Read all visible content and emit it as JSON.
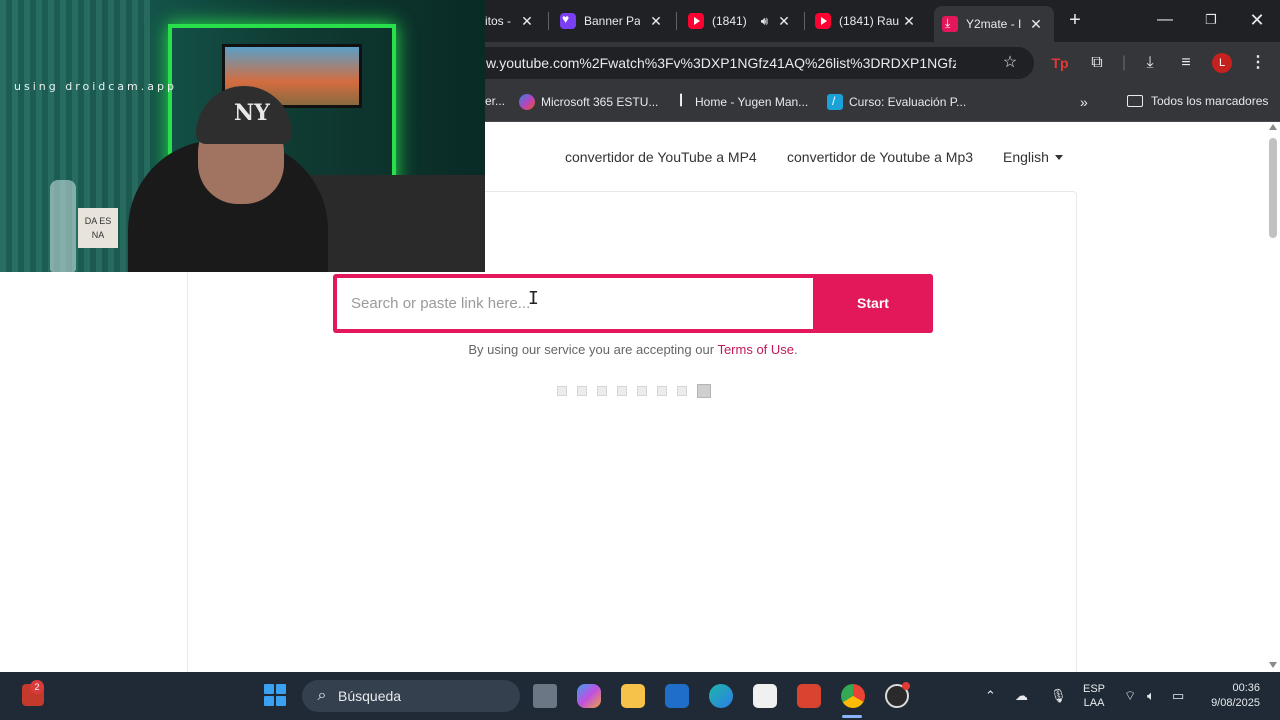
{
  "browser": {
    "tabs": [
      {
        "title": "itos -",
        "favicon": "none",
        "active": false
      },
      {
        "title": "Banner Par",
        "favicon": "canva-heart-icon",
        "active": false
      },
      {
        "title": "(1841)",
        "favicon": "youtube-icon",
        "active": false,
        "audio": true
      },
      {
        "title": "(1841) Rau",
        "favicon": "youtube-icon",
        "active": false
      },
      {
        "title": "Y2mate - I",
        "favicon": "y2mate-icon",
        "active": true
      }
    ],
    "new_tab_label": "+",
    "url": "w.youtube.com%2Fwatch%3Fv%3DXP1NGfz41AQ%26list%3DRDXP1NGfz41AQ...",
    "profile_initial": "L",
    "bookmarks": [
      {
        "label": "er...",
        "icon": "none"
      },
      {
        "label": "Microsoft 365 ESTU...",
        "icon": "microsoft-365-icon"
      },
      {
        "label": "Home - Yugen Man...",
        "icon": "yugen-icon"
      },
      {
        "label": "Curso: Evaluación P...",
        "icon": "course-icon"
      }
    ],
    "all_bookmarks_label": "Todos los marcadores"
  },
  "page": {
    "nav": {
      "mp4_link": "convertidor de YouTube a MP4",
      "mp3_link": "convertidor de Youtube a Mp3",
      "language": "English"
    },
    "search": {
      "placeholder": "Search or paste link here...",
      "button_label": "Start"
    },
    "terms": {
      "prefix": "By using our service you are accepting our ",
      "link": "Terms of Use",
      "suffix": "."
    },
    "loader": {
      "total": 8,
      "active_index": 7
    },
    "accent_color": "#e2185b"
  },
  "webcam": {
    "watermark": "using droidcam.app",
    "cap_logo": "NY",
    "sign_text": "DA ES\nNA"
  },
  "taskbar": {
    "weather_badge": "2",
    "search_label": "Búsqueda",
    "language": "ESP",
    "language_sub": "LAA",
    "time": "00:36",
    "date": "9/08/2025"
  }
}
